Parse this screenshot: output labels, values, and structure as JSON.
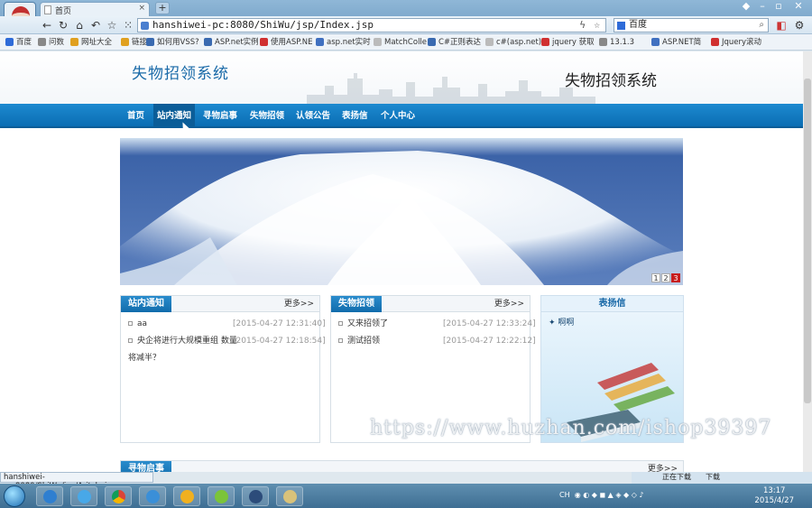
{
  "browser": {
    "tab_title": "首页",
    "tab_close": "×",
    "new_tab": "+",
    "url": "hanshiwei-pc:8080/ShiWu/jsp/Index.jsp",
    "search_engine": "百度",
    "bookmarks": [
      "百度",
      "问数",
      "网址大全",
      "链接",
      "如何用VSS?",
      "ASP.net实例",
      "使用ASP.NE",
      "asp.net实时",
      "MatchColle",
      "C#正则表达",
      "c#(asp.net)",
      "jquery 获取",
      "13.1.3",
      "ASP.NET简",
      "Jquery滚动"
    ],
    "status_url": "hanshiwei-pc:8080/ShiWu/jsp/Aritcle.jsp",
    "tray_labels": [
      "正在下载",
      "下载"
    ],
    "time": "13:17",
    "date": "2015/4/27",
    "ime": "CH"
  },
  "site": {
    "title": "失物招领系统",
    "title_right": "失物招领系统",
    "nav": [
      "首页",
      "站内通知",
      "寻物启事",
      "失物招领",
      "认领公告",
      "表扬信",
      "个人中心"
    ],
    "pager": [
      "1",
      "2",
      "3"
    ]
  },
  "panels": {
    "notice": {
      "title": "站内通知",
      "more": "更多>>",
      "items": [
        {
          "text": "aa",
          "date": "[2015-04-27 12:31:40]"
        },
        {
          "text": "央企将进行大规模重组 数量将减半？",
          "date": "[2015-04-27 12:18:54]"
        }
      ]
    },
    "lost": {
      "title": "失物招领",
      "more": "更多>>",
      "items": [
        {
          "text": "又来招领了",
          "date": "[2015-04-27 12:33:24]"
        },
        {
          "text": "测试招领",
          "date": "[2015-04-27 12:22:12]"
        }
      ]
    },
    "praise": {
      "title": "表扬信",
      "items": [
        "啊啊"
      ]
    },
    "search": {
      "title": "寻物启事",
      "more": "更多>>"
    }
  },
  "watermark": "https://www.huzhan.com/ishop39397",
  "colors": {
    "nav_blue": "#0a6db3",
    "title_blue": "#1a6aa8",
    "pager_active": "#c71d1d"
  }
}
